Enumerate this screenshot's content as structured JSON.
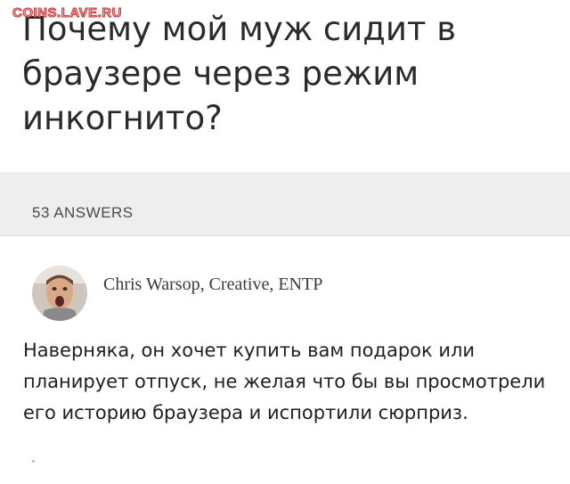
{
  "watermark": "COINS.LAVE.RU",
  "question": {
    "title": "Почему мой муж сидит в браузере через режим инкогнито?"
  },
  "answers": {
    "count_label": "53 ANSWERS"
  },
  "answer": {
    "author": "Chris Warsop, Creative, ENTP",
    "avatar_icon": "user-avatar-photo",
    "text": "Наверняка, он хочет купить вам подарок или планирует отпуск, не желая что бы вы просмотрели его историю браузера и испортили сюрприз.",
    "footer_mark": "˄"
  }
}
